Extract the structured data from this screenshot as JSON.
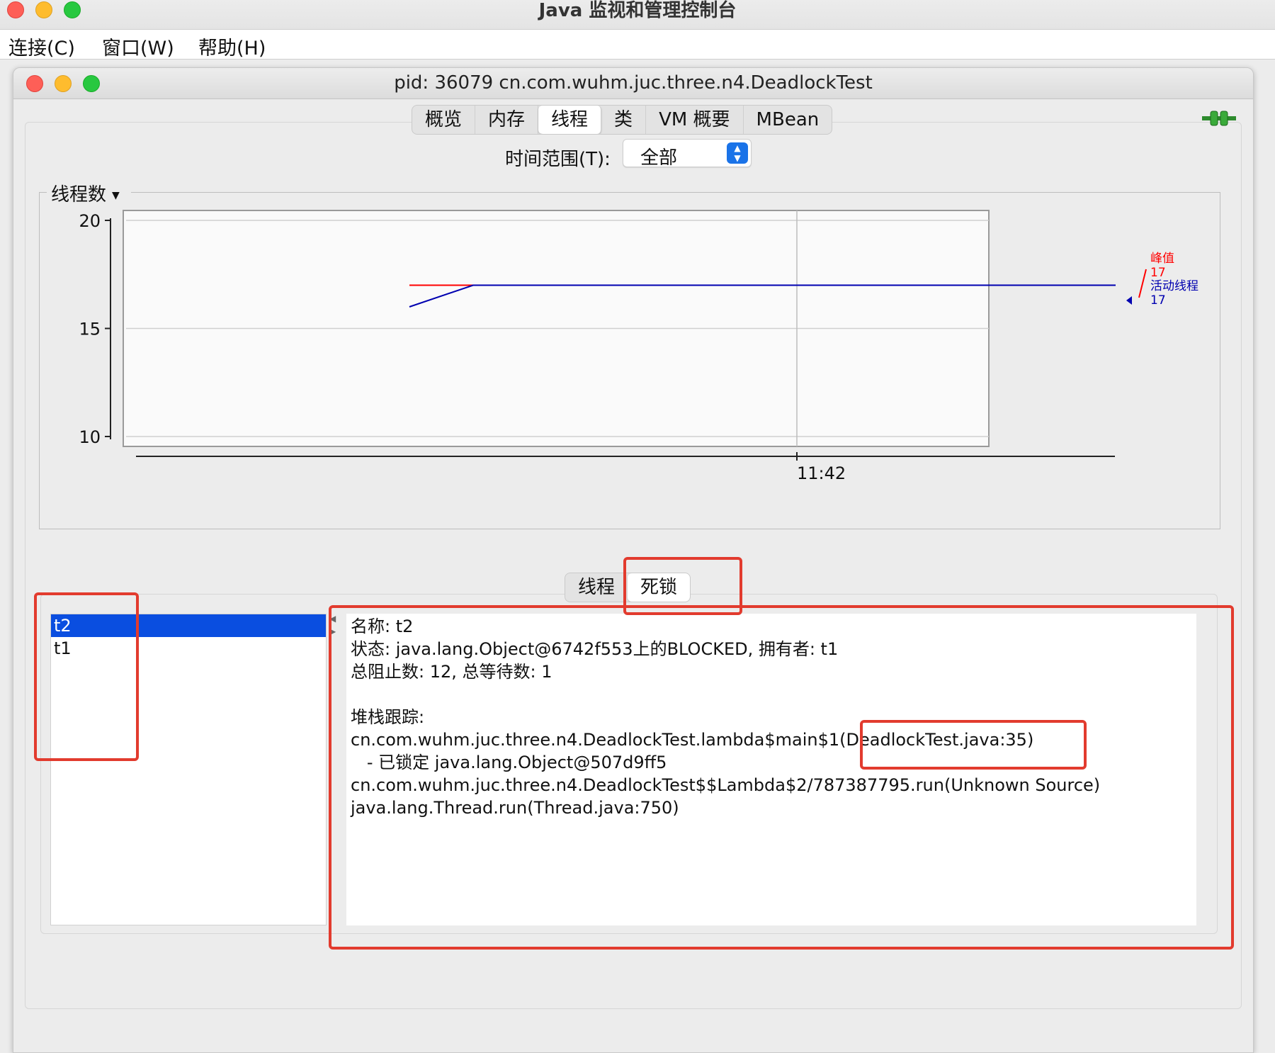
{
  "app": {
    "title": "Java 监视和管理控制台"
  },
  "menu": {
    "connect": "连接(C)",
    "window": "窗口(W)",
    "help": "帮助(H)"
  },
  "window": {
    "title": "pid: 36079 cn.com.wuhm.juc.three.n4.DeadlockTest"
  },
  "tabs": [
    {
      "label": "概览",
      "active": false
    },
    {
      "label": "内存",
      "active": false
    },
    {
      "label": "线程",
      "active": true
    },
    {
      "label": "类",
      "active": false
    },
    {
      "label": "VM 概要",
      "active": false
    },
    {
      "label": "MBean",
      "active": false
    }
  ],
  "time_range": {
    "label": "时间范围(T):",
    "value": "全部"
  },
  "chart_group": {
    "title": "线程数"
  },
  "chart_data": {
    "type": "line",
    "ylim": [
      10,
      20
    ],
    "yticks": [
      "20",
      "15",
      "10"
    ],
    "xticks": [
      "11:42"
    ],
    "series": [
      {
        "name": "峰值",
        "color": "#ff0000",
        "values": [
          17,
          17,
          17
        ]
      },
      {
        "name": "活动线程",
        "color": "#0000b0",
        "values": [
          16,
          17,
          17
        ]
      }
    ],
    "legend": [
      {
        "name": "峰值",
        "value": "17",
        "color": "#ff0000"
      },
      {
        "name": "活动线程",
        "value": "17",
        "color": "#0000b0"
      }
    ]
  },
  "lower_tabs": [
    {
      "label": "线程",
      "active": false
    },
    {
      "label": "死锁",
      "active": true
    }
  ],
  "threads": [
    {
      "name": "t2",
      "selected": true
    },
    {
      "name": "t1",
      "selected": false
    }
  ],
  "detail": {
    "name_line": "名称: t2",
    "state_line": "状态: java.lang.Object@6742f553上的BLOCKED, 拥有者: t1",
    "counts_line": "总阻止数: 12, 总等待数: 1",
    "blank": "",
    "stack_header": "堆栈跟踪:",
    "stack": [
      "cn.com.wuhm.juc.three.n4.DeadlockTest.lambda$main$1(DeadlockTest.java:35)",
      "   - 已锁定 java.lang.Object@507d9ff5",
      "cn.com.wuhm.juc.three.n4.DeadlockTest$$Lambda$2/787387795.run(Unknown Source)",
      "java.lang.Thread.run(Thread.java:750)"
    ]
  },
  "colors": {
    "annotation": "#e23b2e",
    "selection": "#0a4ee0"
  }
}
